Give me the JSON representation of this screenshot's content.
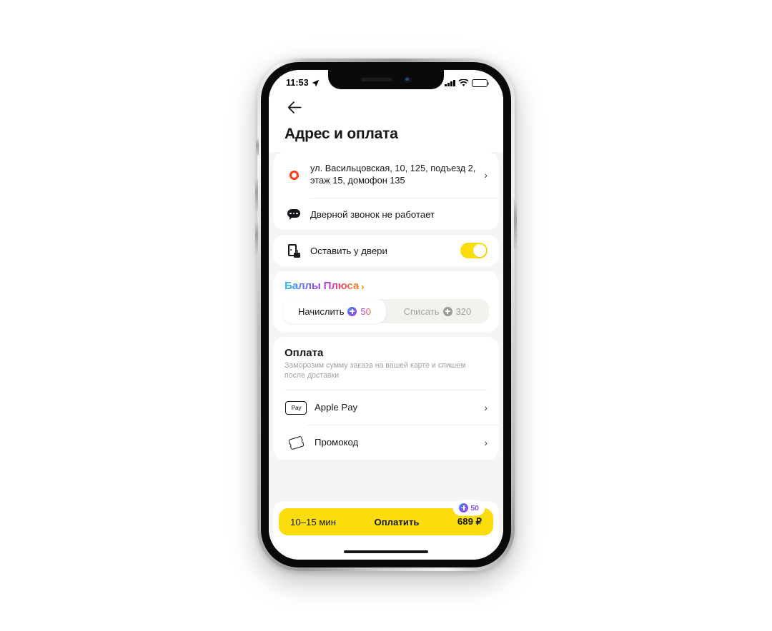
{
  "status_bar": {
    "time": "11:53",
    "location_icon": "location-arrow-icon",
    "signal_icon": "cellular-signal-icon",
    "wifi_icon": "wifi-icon",
    "battery_icon": "battery-full-icon"
  },
  "header": {
    "back_icon": "arrow-left-icon",
    "title": "Адрес и оплата"
  },
  "address_card": {
    "pin_icon": "map-pin-icon",
    "address": "ул. Васильцовская, 10, 125, подъезд 2, этаж 15, домофон 135",
    "address_chevron": "chevron-right-icon",
    "comment_icon": "chat-bubble-icon",
    "comment": "Дверной звонок не работает"
  },
  "door_card": {
    "icon": "door-lock-icon",
    "label": "Оставить у двери",
    "toggle_state": "on",
    "toggle_color": "#FBDD0D"
  },
  "plus_card": {
    "title": "Баллы Плюса",
    "title_chevron": "chevron-right-icon",
    "segments": [
      {
        "label": "Начислить",
        "badge_icon": "plus-badge-icon",
        "value": "50",
        "active": true
      },
      {
        "label": "Списать",
        "badge_icon": "plus-badge-icon",
        "value": "320",
        "active": false
      }
    ]
  },
  "payment_card": {
    "title": "Оплата",
    "subtitle": "Заморозим сумму заказа на вашей карте и спишем после доставки",
    "methods": [
      {
        "icon": "apple-pay-icon",
        "apple_glyph": "",
        "apple_word": "Pay",
        "label": "Apple Pay",
        "chevron": "chevron-right-icon"
      },
      {
        "icon": "promo-ticket-icon",
        "label": "Промокод",
        "chevron": "chevron-right-icon"
      }
    ]
  },
  "bottom_bar": {
    "eta": "10–15 мин",
    "cta": "Оплатить",
    "price": "689 ₽",
    "bonus_badge_icon": "plus-badge-icon",
    "bonus_value": "50",
    "button_color": "#FBDD0D"
  }
}
